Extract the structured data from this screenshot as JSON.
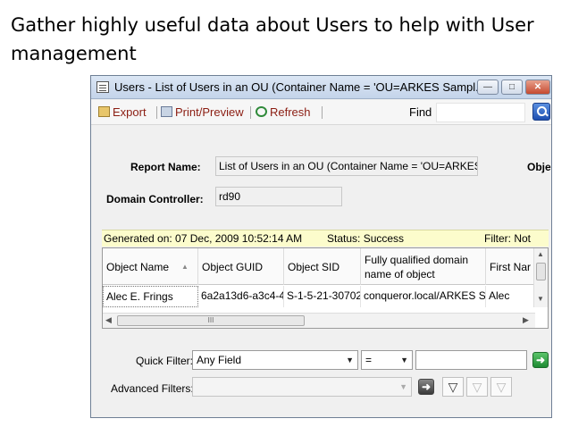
{
  "slide": {
    "title": "Gather highly useful data about Users to help with User management"
  },
  "window": {
    "title": "Users - List of Users in an OU  (Container Name = 'OU=ARKES Sampl...",
    "controls": {
      "minimize": "—",
      "maximize": "□",
      "close": "✕"
    },
    "app_icon": "report-window-icon"
  },
  "toolbar": {
    "export_label": "Export",
    "print_label": "Print/Preview",
    "refresh_label": "Refresh",
    "find_label": "Find",
    "find_value": "",
    "icons": [
      "export-icon",
      "print-icon",
      "refresh-icon",
      "search-icon"
    ]
  },
  "report_info": {
    "report_name_label": "Report Name:",
    "report_name_value": "List of Users in an OU  (Container Name = 'OU=ARKES Sa",
    "object_label": "Obje",
    "dc_label": "Domain Controller:",
    "dc_value": "rd90"
  },
  "status": {
    "generated": "Generated on: 07 Dec, 2009 10:52:14 AM",
    "status": "Status: Success",
    "filter": "Filter: Not"
  },
  "grid": {
    "columns": [
      "Object Name",
      "Object GUID",
      "Object SID",
      "Fully qualified domain name of object",
      "First Nar"
    ],
    "rows": [
      [
        "Alec E. Frings",
        "6a2a13d6-a3c4-4",
        "S-1-5-21-30702",
        "conqueror.local/ARKES S",
        "Alec"
      ]
    ],
    "scroll_thumb": "III"
  },
  "filters": {
    "quick_label": "Quick Filter:",
    "quick_field": "Any Field",
    "operator": "=",
    "quick_value": "",
    "advanced_label": "Advanced Filters:",
    "advanced_value": ""
  },
  "colors": {
    "toolbar_text": "#8b1d12",
    "status_bg": "#fcfccc",
    "title_bar": "#c4d4ea"
  }
}
